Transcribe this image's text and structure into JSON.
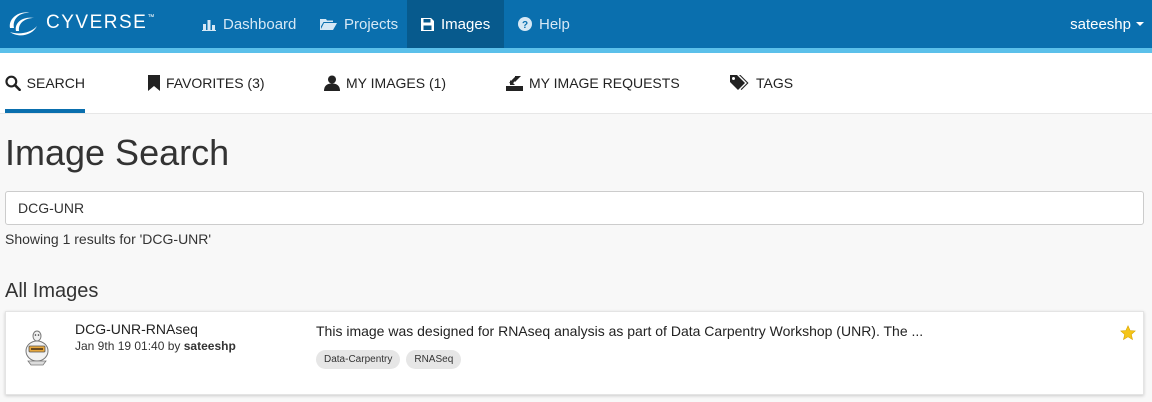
{
  "brand": {
    "name": "CYVERSE",
    "tm": "™"
  },
  "nav": {
    "items": [
      {
        "label": "Dashboard",
        "icon": "bar-chart-icon"
      },
      {
        "label": "Projects",
        "icon": "folder-open-icon"
      },
      {
        "label": "Images",
        "icon": "floppy-disk-icon",
        "active": true
      },
      {
        "label": "Help",
        "icon": "question-circle-icon"
      }
    ],
    "user": "sateeshp"
  },
  "subtabs": [
    {
      "label": "SEARCH",
      "icon": "search-icon",
      "active": true
    },
    {
      "label": "FAVORITES (3)",
      "icon": "bookmark-icon"
    },
    {
      "label": "MY IMAGES (1)",
      "icon": "user-icon"
    },
    {
      "label": "MY IMAGE REQUESTS",
      "icon": "import-icon"
    },
    {
      "label": "TAGS",
      "icon": "tags-icon"
    }
  ],
  "page": {
    "title": "Image Search",
    "search_value": "DCG-UNR",
    "results_text": "Showing 1 results for 'DCG-UNR'",
    "section_title": "All Images"
  },
  "images": [
    {
      "name": "DCG-UNR-RNAseq",
      "date": "Jan 9th 19 01:40 by ",
      "author": "sateeshp",
      "description": "This image was designed for RNAseq analysis as part of Data Carpentry Workshop (UNR). The ...",
      "tags": [
        "Data-Carpentry",
        "RNASeq"
      ],
      "favorite": true
    }
  ],
  "colors": {
    "navbar": "#0a6fae",
    "navbar_active": "#075a8d",
    "accent": "#5bc0ea",
    "star": "#f5c518"
  }
}
